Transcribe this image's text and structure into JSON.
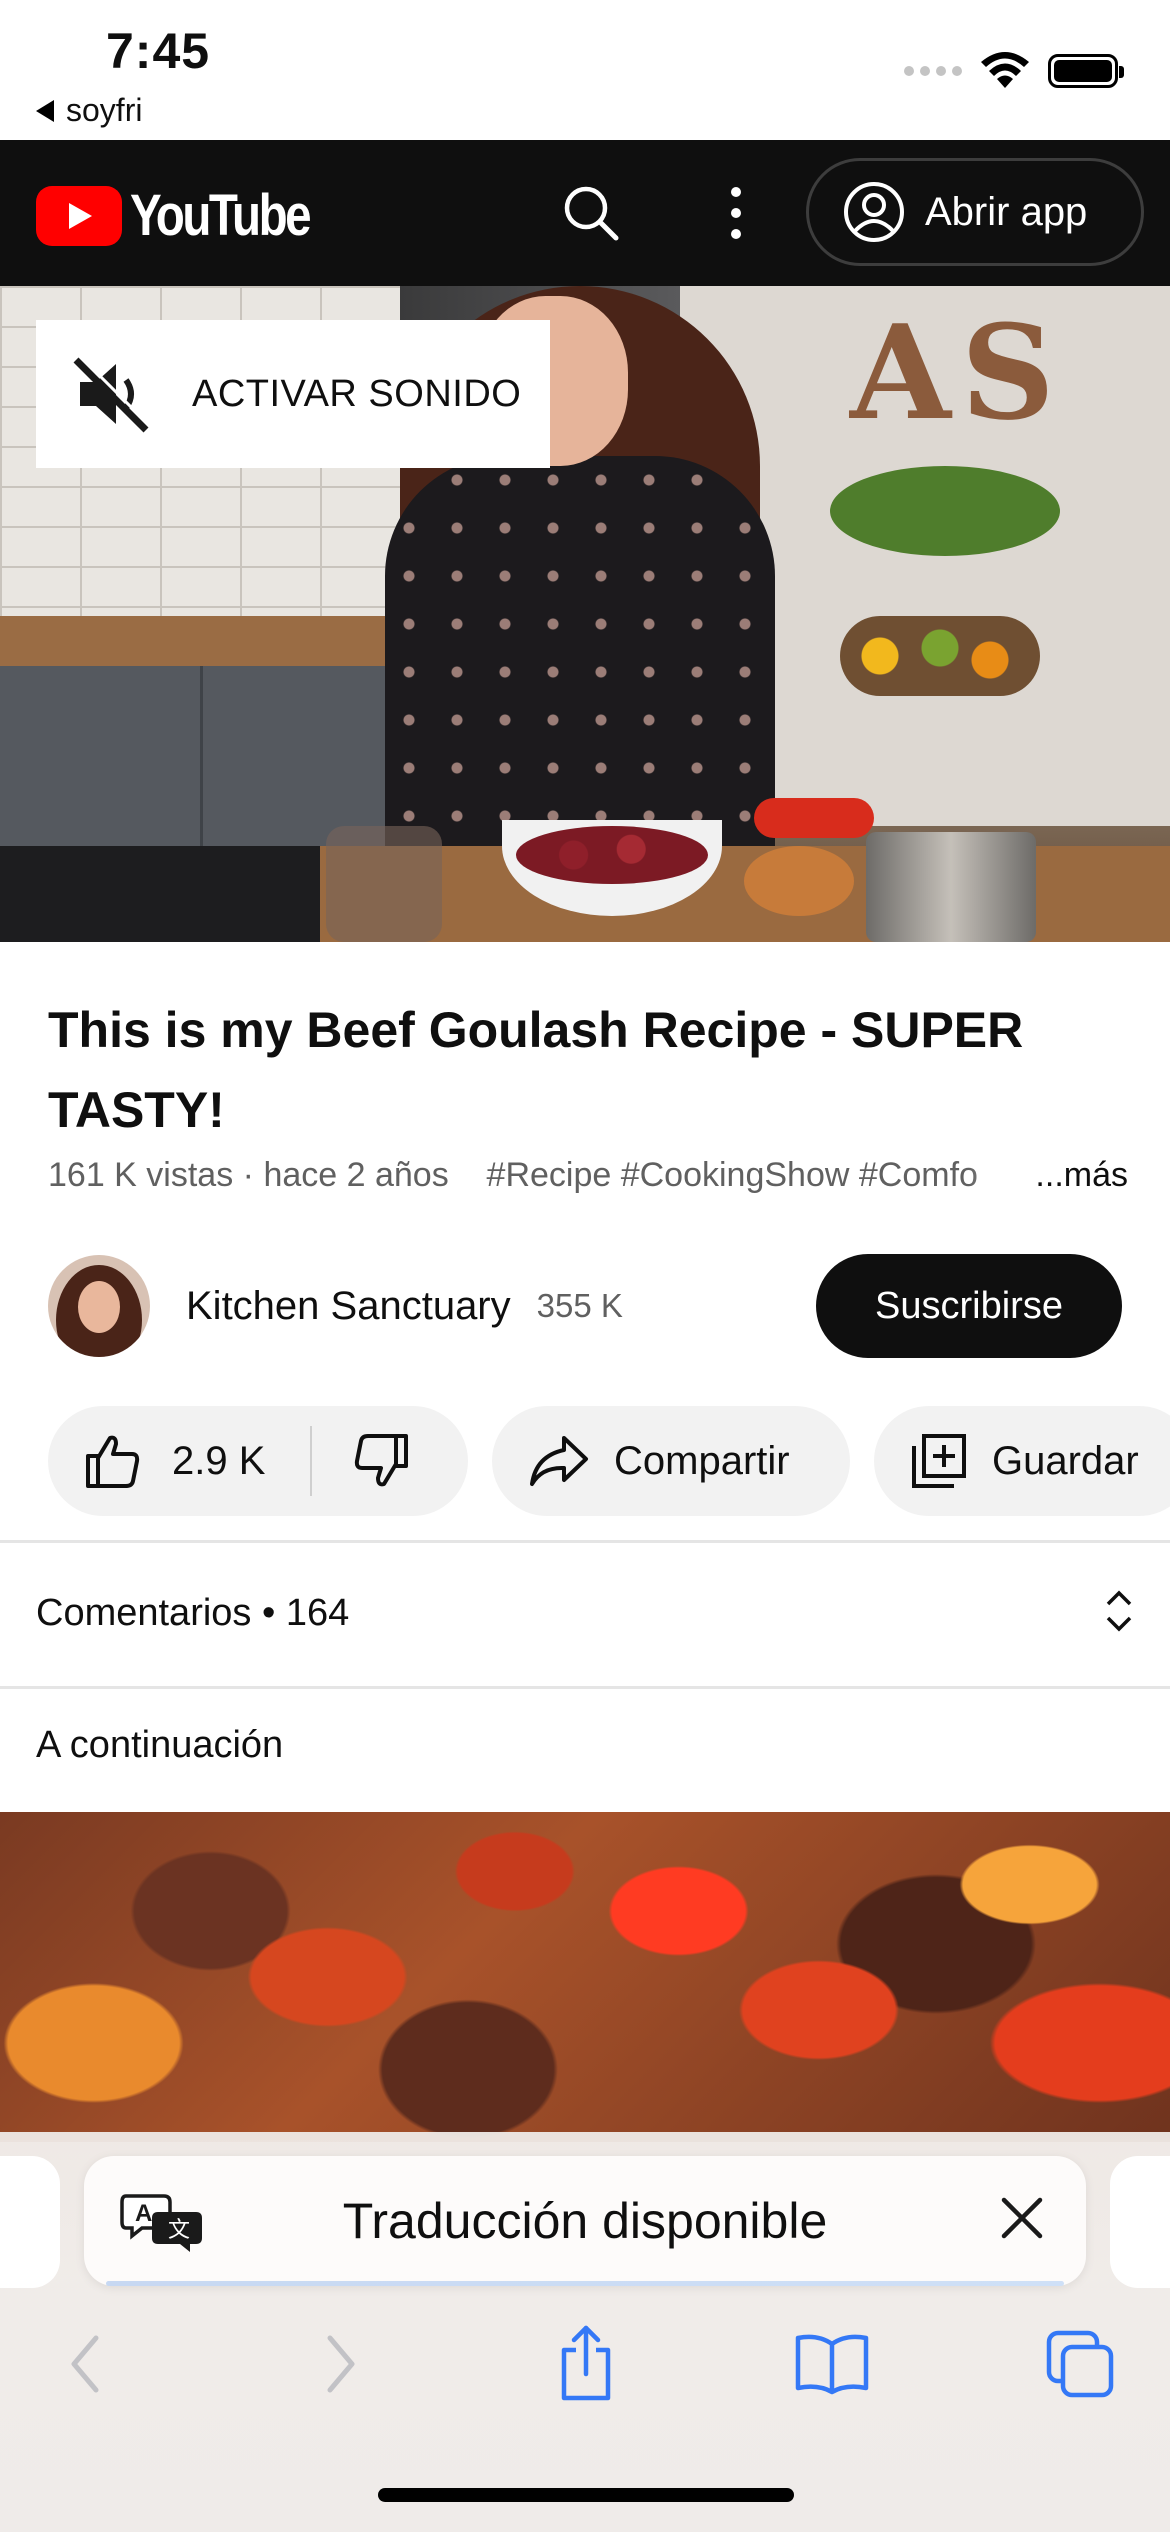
{
  "status_bar": {
    "time": "7:45",
    "back_label": "soyfri"
  },
  "header": {
    "logo_text": "YouTube",
    "open_app_label": "Abrir app"
  },
  "video": {
    "unmute_label": "ACTIVAR SONIDO"
  },
  "info": {
    "title": "This is my Beef Goulash Recipe - SUPER TASTY!",
    "views": "161 K vistas",
    "age": "hace 2 años",
    "hashtags": "#Recipe #CookingShow #Comfo",
    "more_label": "...más"
  },
  "channel": {
    "name": "Kitchen Sanctuary",
    "subscribers": "355 K",
    "subscribe_label": "Suscribirse"
  },
  "actions": {
    "likes": "2.9 K",
    "share_label": "Compartir",
    "save_label": "Guardar"
  },
  "comments": {
    "label": "Comentarios",
    "count": "164",
    "separator": " • "
  },
  "up_next": {
    "label": "A continuación"
  },
  "safari": {
    "address_text": "Traducción disponible"
  },
  "colors": {
    "youtube_red": "#ff0000",
    "header_bg": "#0f0f0f",
    "safari_blue": "#3478f6"
  }
}
